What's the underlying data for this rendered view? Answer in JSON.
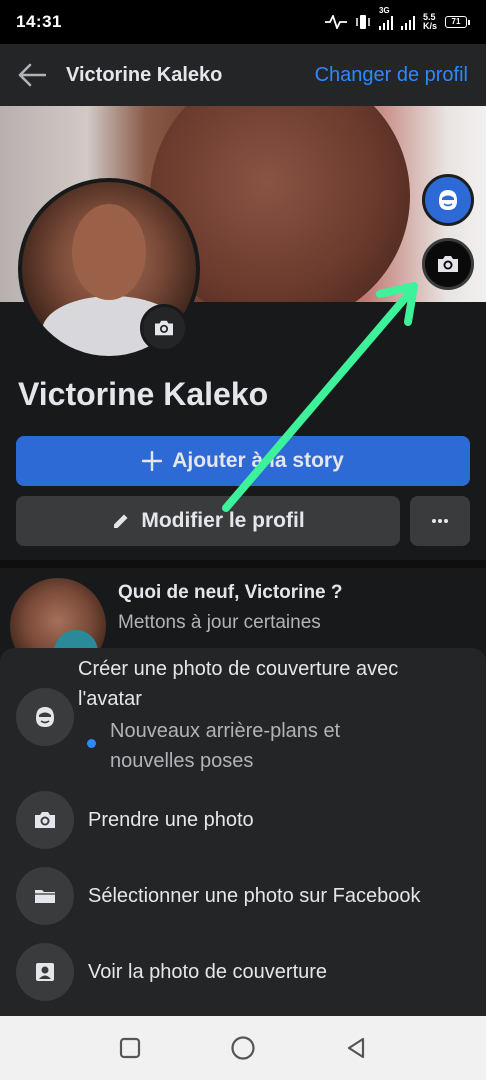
{
  "status_bar": {
    "time": "14:31",
    "network_type": "3G",
    "speed_value": "5.5",
    "speed_unit": "K/s",
    "battery": "71"
  },
  "header": {
    "back_icon": "arrow-left-icon",
    "title": "Victorine Kaleko",
    "switch_profile": "Changer de profil"
  },
  "profile": {
    "name": "Victorine Kaleko",
    "add_story_label": "Ajouter à la story",
    "edit_profile_label": "Modifier le profil",
    "more_icon": "ellipsis-icon"
  },
  "post_prompt": {
    "title": "Quoi de neuf, Victorine ?",
    "subtitle": "Mettons à jour certaines"
  },
  "sheet": {
    "options": [
      {
        "label": "Créer une photo de couverture avec l'avatar",
        "sub": "Nouveaux arrière-plans et nouvelles poses",
        "icon": "avatar-face-icon"
      },
      {
        "label": "Prendre une photo",
        "icon": "camera-icon"
      },
      {
        "label": "Sélectionner une photo sur Facebook",
        "icon": "folder-icon"
      },
      {
        "label": "Voir la photo de couverture",
        "icon": "portrait-icon"
      }
    ]
  },
  "colors": {
    "accent": "#2d88ff",
    "button_blue": "#2d6ad6",
    "annotation_arrow": "#3df29a"
  }
}
